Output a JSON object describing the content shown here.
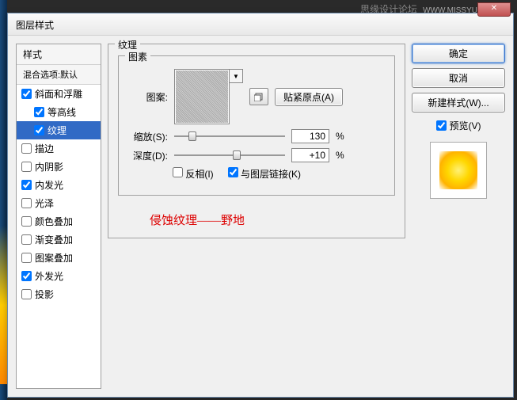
{
  "watermark": {
    "text": "思缘设计论坛",
    "url": "WWW.MISSYUAN.COM"
  },
  "dialog": {
    "title": "图层样式",
    "panel": {
      "header": "样式",
      "blending": "混合选项:默认",
      "items": [
        {
          "label": "斜面和浮雕",
          "checked": true,
          "indent": false,
          "selected": false
        },
        {
          "label": "等高线",
          "checked": true,
          "indent": true,
          "selected": false
        },
        {
          "label": "纹理",
          "checked": true,
          "indent": true,
          "selected": true
        },
        {
          "label": "描边",
          "checked": false,
          "indent": false,
          "selected": false
        },
        {
          "label": "内阴影",
          "checked": false,
          "indent": false,
          "selected": false
        },
        {
          "label": "内发光",
          "checked": true,
          "indent": false,
          "selected": false
        },
        {
          "label": "光泽",
          "checked": false,
          "indent": false,
          "selected": false
        },
        {
          "label": "颜色叠加",
          "checked": false,
          "indent": false,
          "selected": false
        },
        {
          "label": "渐变叠加",
          "checked": false,
          "indent": false,
          "selected": false
        },
        {
          "label": "图案叠加",
          "checked": false,
          "indent": false,
          "selected": false
        },
        {
          "label": "外发光",
          "checked": true,
          "indent": false,
          "selected": false
        },
        {
          "label": "投影",
          "checked": false,
          "indent": false,
          "selected": false
        }
      ]
    },
    "texture": {
      "section": "纹理",
      "element": "图素",
      "pattern_label": "图案:",
      "snap_btn": "贴紧原点(A)",
      "scale_label": "缩放(S):",
      "scale_value": "130",
      "depth_label": "深度(D):",
      "depth_value": "+10",
      "percent": "%",
      "invert": "反相(I)",
      "link": "与图层链接(K)",
      "invert_checked": false,
      "link_checked": true
    },
    "note": "侵蚀纹理——野地",
    "buttons": {
      "ok": "确定",
      "cancel": "取消",
      "newstyle": "新建样式(W)...",
      "preview": "预览(V)"
    }
  }
}
